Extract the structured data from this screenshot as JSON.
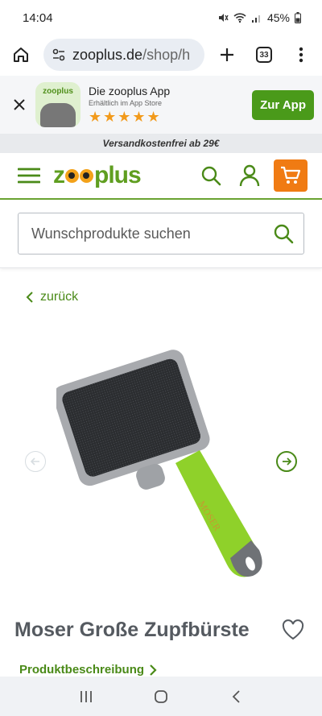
{
  "status_bar": {
    "time": "14:04",
    "battery": "45%"
  },
  "browser": {
    "url_domain": "zooplus.de",
    "url_path": "/shop/h",
    "tab_count": "33"
  },
  "app_banner": {
    "title": "Die zooplus App",
    "subtitle": "Erhältlich im App Store",
    "stars": "★★★★★",
    "logo_text": "zooplus",
    "button": "Zur App"
  },
  "shipping_notice": "Versandkostenfrei ab 29€",
  "header": {
    "logo_prefix": "z",
    "logo_suffix": "plus"
  },
  "search": {
    "placeholder": "Wunschprodukte suchen"
  },
  "back_link": "zurück",
  "product": {
    "title": "Moser Große Zupfbürste",
    "description_link": "Produktbeschreibung",
    "brand_on_handle": "MOSER"
  },
  "colors": {
    "brand_green": "#4a9a1a",
    "cart_orange": "#f07b13",
    "star_orange": "#f29a1b"
  }
}
